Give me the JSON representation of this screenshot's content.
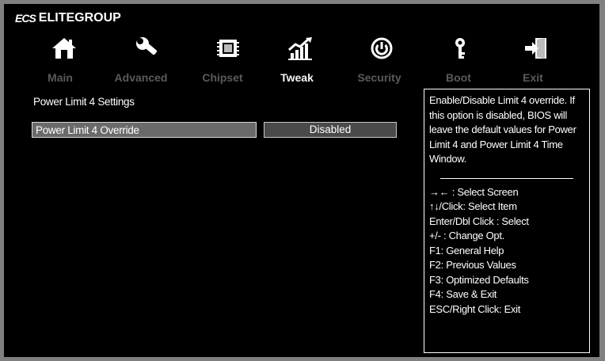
{
  "brand": {
    "logo": "ECS",
    "name": "ELITEGROUP"
  },
  "tabs": [
    {
      "label": "Main",
      "icon": "home-icon"
    },
    {
      "label": "Advanced",
      "icon": "wrench-icon"
    },
    {
      "label": "Chipset",
      "icon": "chip-icon"
    },
    {
      "label": "Tweak",
      "icon": "chart-icon"
    },
    {
      "label": "Security",
      "icon": "power-icon"
    },
    {
      "label": "Boot",
      "icon": "key-icon"
    },
    {
      "label": "Exit",
      "icon": "exit-icon"
    }
  ],
  "active_tab": "Tweak",
  "main": {
    "section_title": "Power Limit 4 Settings",
    "option": {
      "label": "Power Limit 4 Override",
      "value": "Disabled"
    }
  },
  "help": {
    "description": "Enable/Disable Limit 4 override. If this option is disabled, BIOS will leave the default values for Power Limit 4 and Power Limit 4 Time Window.",
    "keys": [
      "→←  : Select Screen",
      "↑↓/Click: Select Item",
      "Enter/Dbl Click : Select",
      "+/- : Change Opt.",
      "F1: General Help",
      "F2: Previous Values",
      "F3: Optimized Defaults",
      "F4: Save & Exit",
      "ESC/Right Click: Exit"
    ]
  },
  "colors": {
    "background": "#808080",
    "header": "#000000",
    "active_tab": "#f5f5f5",
    "inactive_tab": "#5a5a5a"
  }
}
